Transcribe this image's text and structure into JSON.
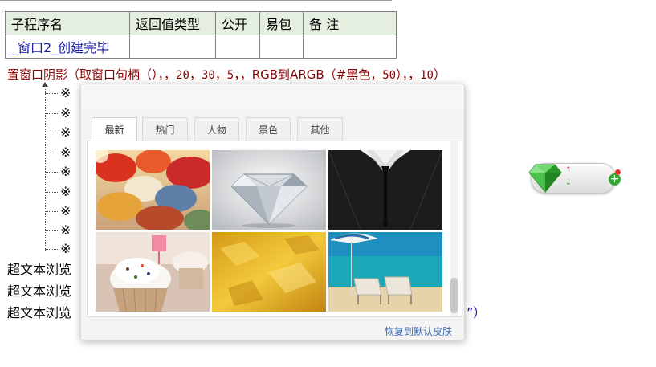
{
  "table": {
    "headers": [
      "子程序名",
      "返回值类型",
      "公开",
      "易包",
      "备 注"
    ],
    "row": [
      "_窗口2_创建完毕",
      "",
      "",
      "",
      ""
    ]
  },
  "code_line": {
    "text1": "置窗口阴影（取窗口句柄（），，",
    "n1": "20",
    "sep1": "，",
    "n2": "30",
    "sep2": "，",
    "n3": "5",
    "sep3": "，，",
    "fn": "RGB到ARGB（#黑色，",
    "n4": "50",
    "sep4": "），，",
    "n5": "10",
    "close": "）"
  },
  "tree_items": [
    "※",
    "※",
    "※",
    "※",
    "※",
    "※",
    "※",
    "※",
    "※"
  ],
  "rich_lines": [
    "超文本浏览",
    "超文本浏览",
    "超文本浏览"
  ],
  "tail_text": "”）",
  "skin_popup": {
    "tabs": [
      "最新",
      "热门",
      "人物",
      "景色",
      "其他"
    ],
    "active_tab": 0,
    "restore_label": "恢复到默认皮肤",
    "thumbnails": [
      "umbrellas",
      "diamond",
      "suit-tie",
      "cupcakes",
      "gold-texture",
      "beach-chairs"
    ]
  },
  "widget": {
    "up_glyph": "↑",
    "down_glyph": "↓",
    "plus_glyph": "+"
  },
  "colors": {
    "accent_link": "#3a6db5",
    "code_red": "#8b0000",
    "code_blue": "#1a1aa8",
    "header_bg": "#e4efe0"
  }
}
